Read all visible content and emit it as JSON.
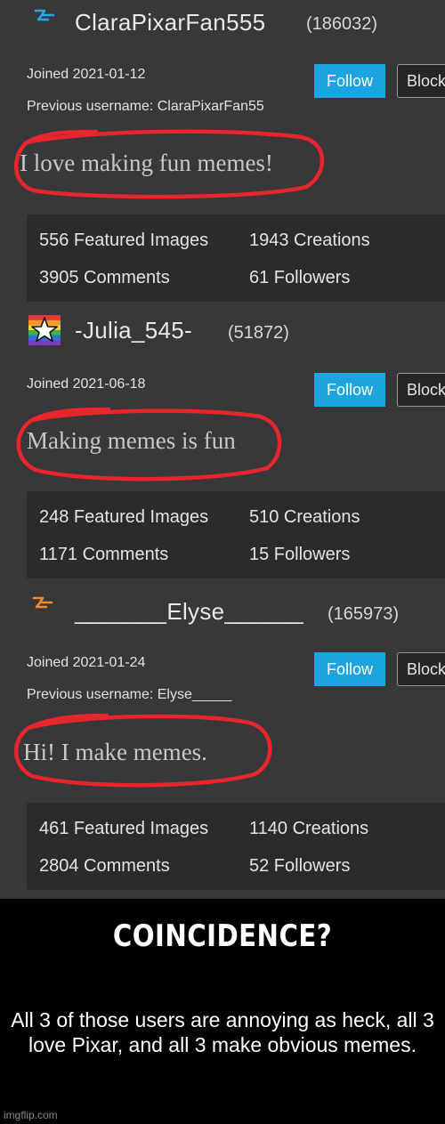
{
  "profiles": [
    {
      "icon": "blue-bolt-icon",
      "username": "ClaraPixarFan555",
      "points": "(186032)",
      "joined": "Joined 2021-01-12",
      "previous": "Previous username: ClaraPixarFan55",
      "follow_label": "Follow",
      "block_label": "Block",
      "bio": "I love making fun memes!",
      "stats": {
        "featured": "556 Featured Images",
        "creations": "1943 Creations",
        "comments": "3905 Comments",
        "followers": "61 Followers"
      }
    },
    {
      "icon": "rainbow-star-icon",
      "username": "-Julia_545-",
      "points": "(51872)",
      "joined": "Joined 2021-06-18",
      "follow_label": "Follow",
      "block_label": "Block",
      "bio": "Making memes is fun",
      "stats": {
        "featured": "248 Featured Images",
        "creations": "510 Creations",
        "comments": "1171 Comments",
        "followers": "15 Followers"
      }
    },
    {
      "icon": "orange-bolt-icon",
      "username": "_______Elyse______",
      "points": "(165973)",
      "joined": "Joined 2021-01-24",
      "previous": "Previous username: Elyse_____",
      "follow_label": "Follow",
      "block_label": "Block",
      "bio": "Hi! I make memes.",
      "stats": {
        "featured": "461 Featured Images",
        "creations": "1140 Creations",
        "comments": "2804 Comments",
        "followers": "52 Followers"
      }
    }
  ],
  "caption": {
    "headline": "COINCIDENCE?",
    "body": "All 3 of those users are annoying as heck, all 3 love Pixar, and all 3 make obvious memes.",
    "watermark": "imgflip.com"
  },
  "colors": {
    "panel_bg": "#38383a",
    "stats_bg": "#2b2b2d",
    "follow_button": "#1ba4e0",
    "highlight_circle": "#e8262b",
    "blue_bolt": "#27a6e6",
    "orange_bolt": "#f08a2c"
  }
}
